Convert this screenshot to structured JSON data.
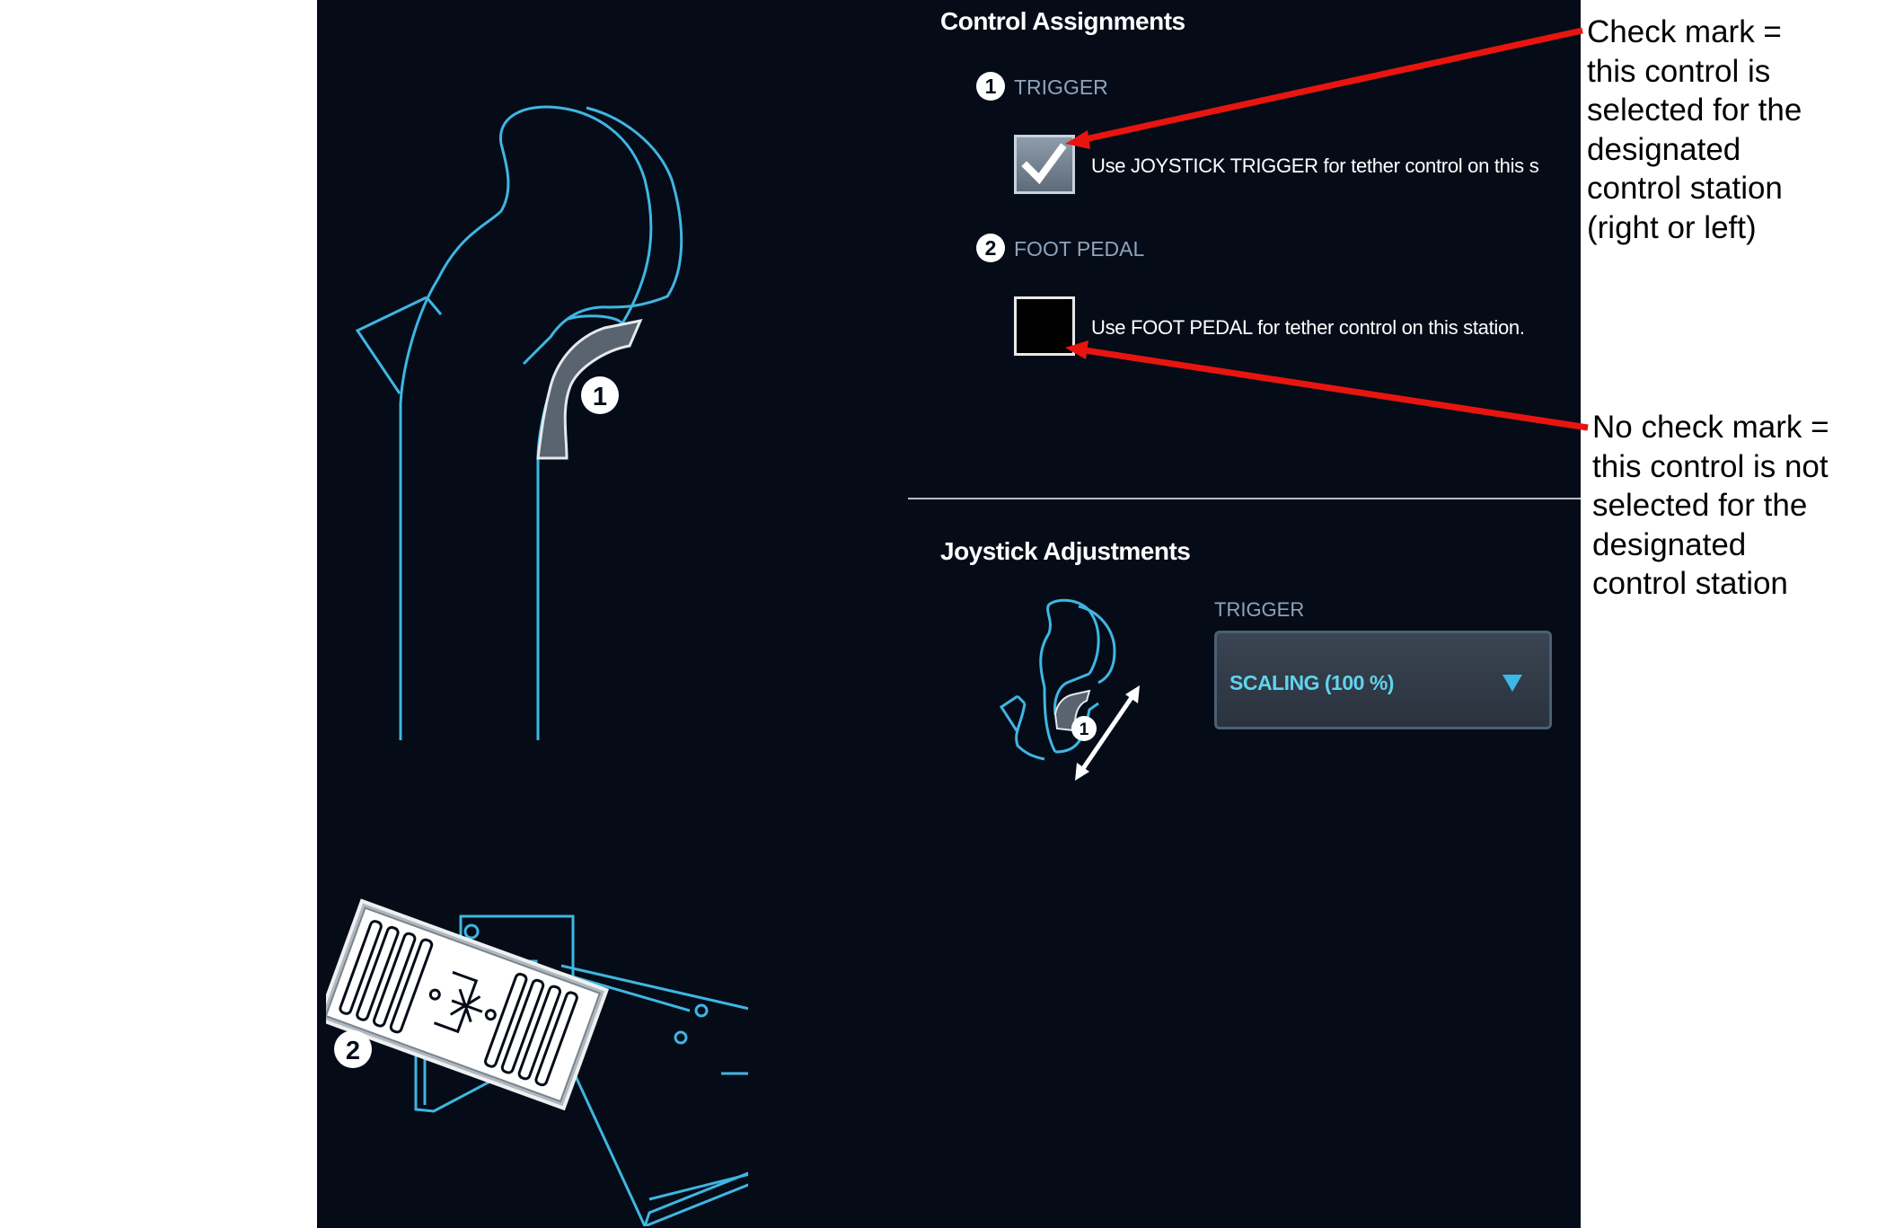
{
  "control_assignments": {
    "title": "Control Assignments",
    "items": [
      {
        "number": "1",
        "label": "TRIGGER",
        "checked": true,
        "description": "Use JOYSTICK TRIGGER for tether control on this s"
      },
      {
        "number": "2",
        "label": "FOOT PEDAL",
        "checked": false,
        "description": "Use FOOT PEDAL for tether control on this station."
      }
    ]
  },
  "joystick_adjustments": {
    "title": "Joystick Adjustments",
    "field_label": "TRIGGER",
    "dropdown_value": "SCALING (100 %)",
    "callout_number": "1"
  },
  "illustrations": {
    "joystick_callout": "1",
    "pedal_callout": "2"
  },
  "annotations": {
    "checked": "Check mark =\nthis control is\nselected for the\ndesignated\ncontrol station\n(right or left)",
    "unchecked": "No check mark =\nthis control is not\nselected for the\ndesignated\ncontrol station"
  },
  "colors": {
    "panel_background": "#050c18",
    "outline": "#3fb6e2",
    "dropdown_text": "#5fd4ee",
    "arrow": "#e8150f"
  },
  "icons": {
    "checkbox_checked": "check-icon",
    "dropdown": "triangle-down-icon",
    "adjust": "double-arrow-icon"
  }
}
